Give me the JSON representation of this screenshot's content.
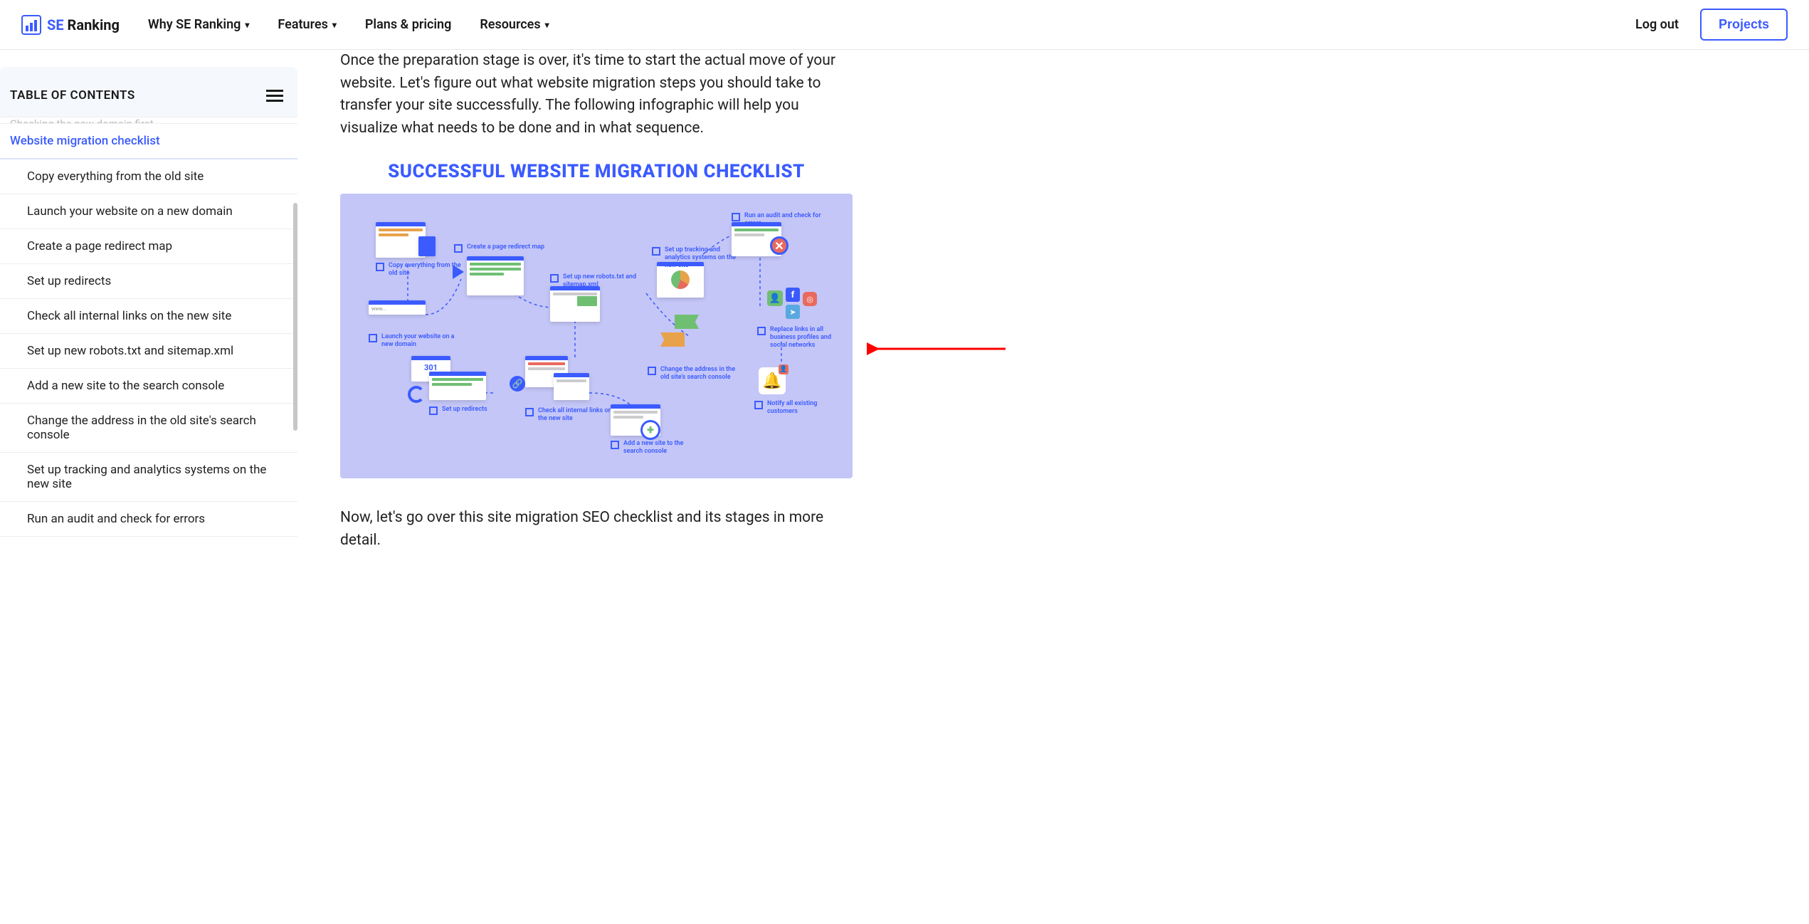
{
  "header": {
    "logo_text_se": "SE",
    "logo_text_rest": " Ranking",
    "nav": {
      "why": "Why SE Ranking",
      "features": "Features",
      "plans": "Plans & pricing",
      "resources": "Resources"
    },
    "logout": "Log out",
    "projects": "Projects"
  },
  "toc": {
    "title": "TABLE OF CONTENTS",
    "cut_item": "Checking the new domain first",
    "active": "Website migration checklist",
    "items": [
      "Copy everything from the old site",
      "Launch your website on a new domain",
      "Create a page redirect map",
      "Set up redirects",
      "Check all internal links on the new site",
      "Set up new robots.txt and sitemap.xml",
      "Add a new site to the search console",
      "Change the address in the old site's search console",
      "Set up tracking and analytics systems on the new site",
      "Run an audit and check for errors"
    ]
  },
  "content": {
    "para1": "Once the preparation stage is over, it's time to start the actual move of your website. Let's figure out what website migration steps you should take to transfer your site successfully. The following infographic will help you visualize what needs to be done and in what sequence.",
    "fig_title": "SUCCESSFUL WEBSITE MIGRATION CHECKLIST",
    "steps": {
      "copy": "Copy everything from the old site",
      "launch": "Launch your website on a new domain",
      "redirect_map": "Create a page redirect map",
      "redirects": "Set up redirects",
      "robots": "Set up new robots.txt and sitemap.xml",
      "check_links": "Check all internal links on the new site",
      "add_console": "Add a new site to the search console",
      "change_addr": "Change the address in the old site's search console",
      "tracking": "Set up tracking and analytics systems on the new site",
      "audit": "Run an audit and check for errors",
      "replace_links": "Replace links in all business profiles and social networks",
      "notify": "Notify all existing customers"
    },
    "www_label": "www...",
    "redirect_code": "301",
    "para2": "Now, let's go over this site migration SEO checklist and its stages in more detail."
  }
}
